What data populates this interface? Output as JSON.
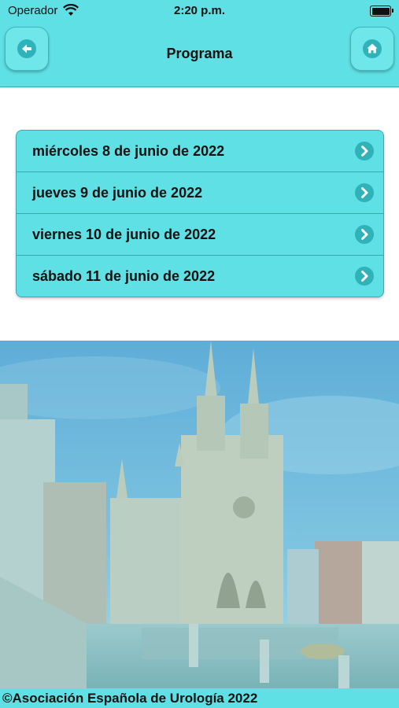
{
  "status_bar": {
    "carrier": "Operador",
    "time": "2:20 p.m.",
    "wifi_icon": "wifi-icon",
    "battery_icon": "battery-icon"
  },
  "navbar": {
    "title": "Programa",
    "back_icon": "back-arrow-icon",
    "home_icon": "home-icon"
  },
  "menu": {
    "items": [
      {
        "label": "miércoles 8 de junio de 2022",
        "icon": "chevron-right-icon"
      },
      {
        "label": "jueves 9 de junio de 2022",
        "icon": "chevron-right-icon"
      },
      {
        "label": "viernes 10 de junio de 2022",
        "icon": "chevron-right-icon"
      },
      {
        "label": "sábado 11 de junio de 2022",
        "icon": "chevron-right-icon"
      }
    ]
  },
  "footer": {
    "copyright": "©Asociación Española de Urología 2022"
  },
  "colors": {
    "accent": "#5fe0e4",
    "accent_dark": "#2fb2b8",
    "border": "#3aa9ad"
  }
}
